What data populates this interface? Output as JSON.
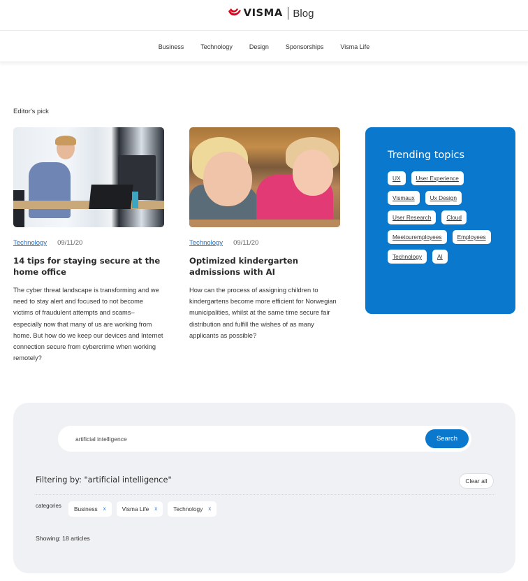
{
  "header": {
    "brand": "VISMA",
    "section": "Blog",
    "brand_color": "#e1001a"
  },
  "nav": {
    "items": [
      "Business",
      "Technology",
      "Design",
      "Sponsorships",
      "Visma Life"
    ]
  },
  "editors_pick": {
    "label": "Editor's pick",
    "articles": [
      {
        "image": "office-worker-photo",
        "category": "Technology",
        "date": "09/11/20",
        "title": "14 tips for staying secure at the home office",
        "excerpt": "The cyber threat landscape is transforming and we need to stay alert and focused to not become victims of fraudulent attempts and scams– especially now that many of us are working from home. But how do we keep our devices and Internet connection secure from cybercrime when working remotely?"
      },
      {
        "image": "children-playground-photo",
        "category": "Technology",
        "date": "09/11/20",
        "title": "Optimized kindergarten admissions with AI",
        "excerpt": "How can the process of assigning children to kindergartens become more efficient for Norwegian municipalities, whilst at the same time secure fair distribution and fulfill the wishes of as many applicants as possible?"
      }
    ]
  },
  "trending": {
    "title": "Trending topics",
    "accent": "#0a78cc",
    "tags": [
      "UX",
      "User Experience",
      "Vismaux",
      "Ux Design",
      "User Research",
      "Cloud",
      "Meetouremployees",
      "Employees",
      "Technology",
      "AI"
    ]
  },
  "search": {
    "value": "artificial intelligence",
    "button_label": "Search",
    "filter_title": "Filtering by: \"artificial intelligence\"",
    "clear_label": "Clear all",
    "categories_label": "categories",
    "active_filters": [
      {
        "label": "Business",
        "remove": "x"
      },
      {
        "label": "Visma Life",
        "remove": "x"
      },
      {
        "label": "Technology",
        "remove": "x"
      }
    ],
    "showing": "Showing:  18 articles"
  }
}
